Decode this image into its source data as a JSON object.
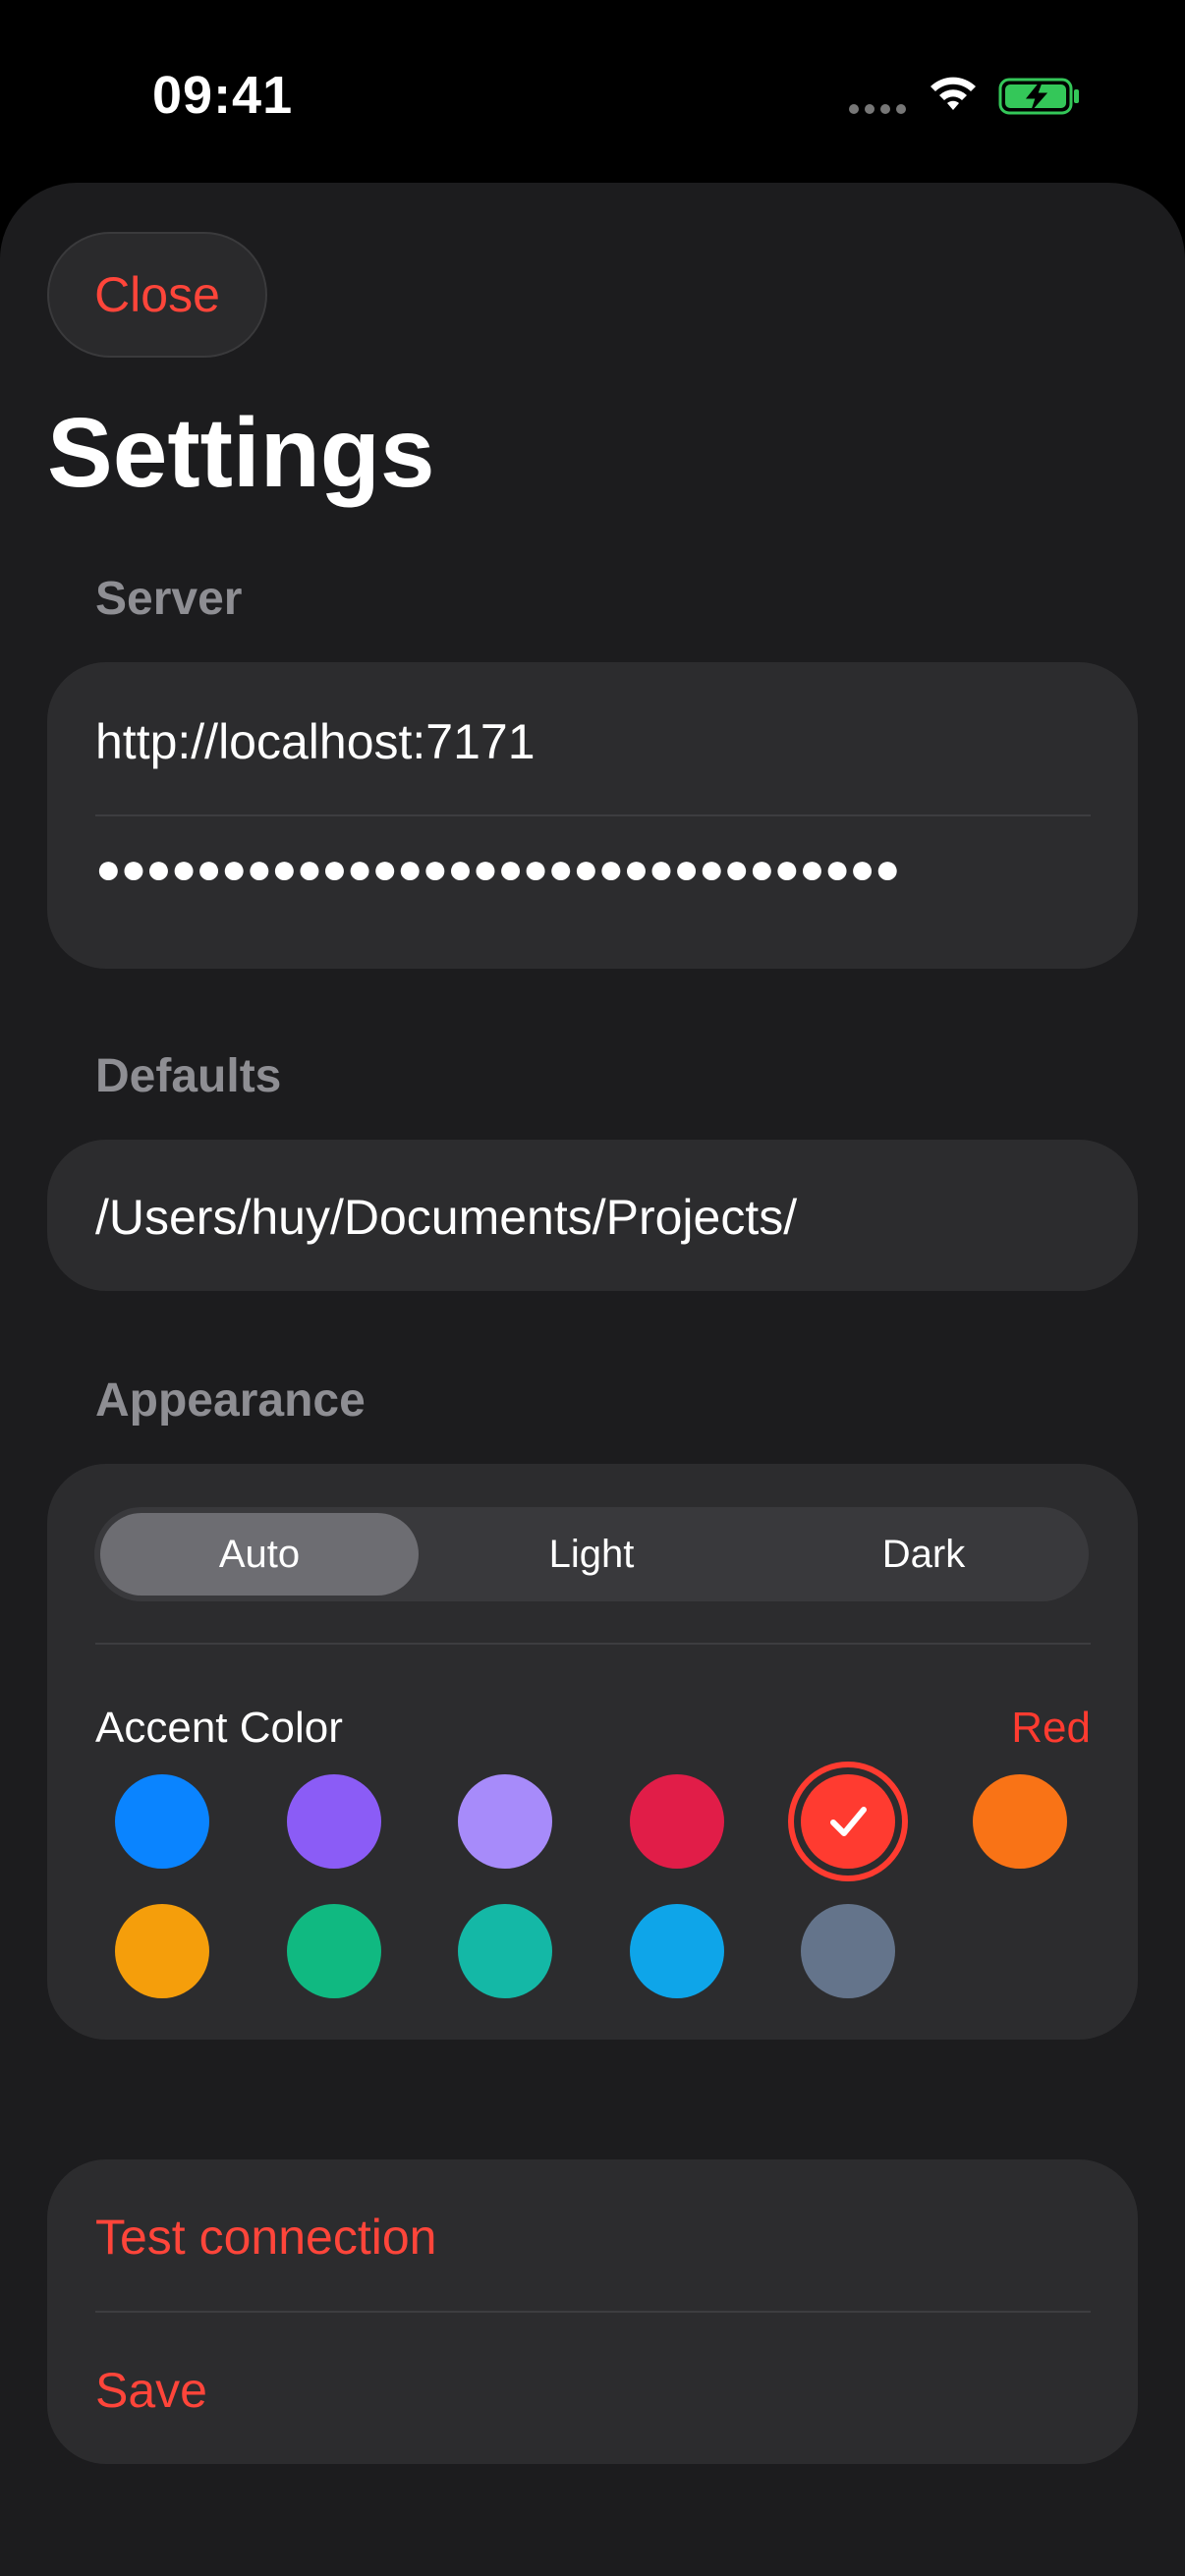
{
  "status_bar": {
    "time": "09:41"
  },
  "sheet": {
    "close_label": "Close",
    "title": "Settings"
  },
  "server": {
    "section_label": "Server",
    "url_value": "http://localhost:7171",
    "token_value": "●●●●●●●●●●●●●●●●●●●●●●●●●●●●●●●●"
  },
  "defaults": {
    "section_label": "Defaults",
    "path_value": "/Users/huy/Documents/Projects/"
  },
  "appearance": {
    "section_label": "Appearance",
    "modes": [
      "Auto",
      "Light",
      "Dark"
    ],
    "selected_mode": "Auto",
    "accent_label": "Accent Color",
    "accent_value": "Red",
    "accent_colors": [
      "#0a84ff",
      "#8b5cf6",
      "#a78bfa",
      "#e11d48",
      "#ff3b30",
      "#f97316",
      "#f59e0b",
      "#10b981",
      "#14b8a6",
      "#0ea5e9",
      "#64748b"
    ],
    "selected_color_index": 4
  },
  "actions": {
    "test_label": "Test connection",
    "save_label": "Save"
  },
  "colors": {
    "accent": "#ff453a",
    "sheet_background": "#1c1c1e",
    "card_background": "#2c2c2e"
  }
}
